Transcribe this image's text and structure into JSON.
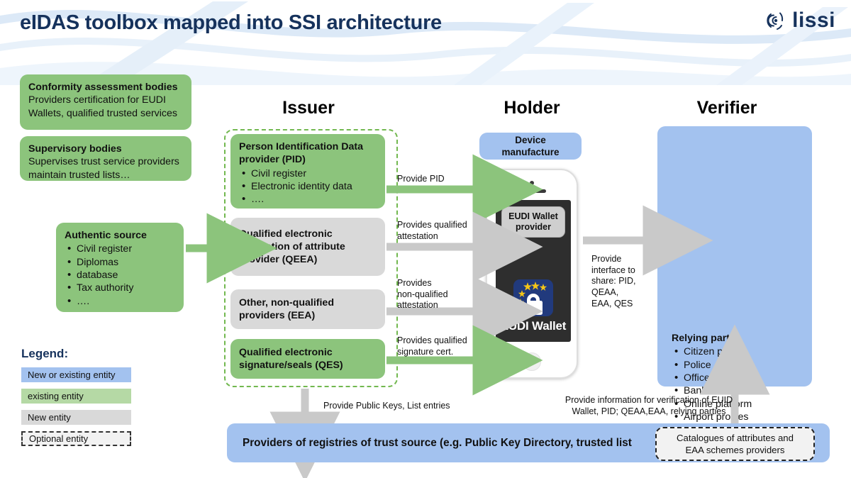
{
  "header": {
    "title": "eIDAS toolbox mapped into SSI architecture",
    "logo_text": "lissi",
    "logo_icon": "fingerprint-icon"
  },
  "columns": {
    "issuer": "Issuer",
    "holder": "Holder",
    "verifier": "Verifier"
  },
  "left_boxes": [
    {
      "title": "Conformity assessment bodies",
      "lines": [
        "Providers certification for EUDI",
        "Wallets, qualified trusted services"
      ]
    },
    {
      "title": "Supervisory bodies",
      "lines": [
        "Supervises trust service providers",
        "maintain trusted lists…"
      ]
    }
  ],
  "authentic_source": {
    "title": "Authentic source",
    "items": [
      "Civil register",
      "Diplomas",
      "database",
      "Tax authority",
      "…."
    ]
  },
  "issuer_boxes": [
    {
      "title_lines": [
        "Person Identification Data",
        "provider (PID)"
      ],
      "items": [
        "Civil register",
        "Electronic identity data",
        "…."
      ],
      "style": "green"
    },
    {
      "title_lines": [
        "Qualified electronic",
        "attestation of attribute",
        "provider (QEEA)"
      ],
      "items": [],
      "style": "gray"
    },
    {
      "title_lines": [
        "Other, non-qualified",
        "providers (EEA)"
      ],
      "items": [],
      "style": "gray"
    },
    {
      "title_lines": [
        "Qualified electronic",
        "signature/seals (QES)"
      ],
      "items": [],
      "style": "green"
    }
  ],
  "holder": {
    "device_manufacture": [
      "Device",
      "manufacture"
    ],
    "wallet_provider": [
      "EUDI Wallet",
      "provider"
    ],
    "wallet_label": "EUDI Wallet",
    "eu_badge_icon": "eu-flag-padlock-icon"
  },
  "verifier": {
    "title": "Relying party",
    "items": [
      "Citizen portal",
      "Police",
      "Officer",
      "Bank",
      "Online platform",
      "Airport proxies"
    ]
  },
  "arrow_labels": {
    "provide_pid": "Provide PID",
    "qualified_attestation": [
      "Provides qualified",
      "attestation"
    ],
    "non_qualified_attestation": [
      "Provides",
      "non-qualified",
      "attestation"
    ],
    "qualified_signature": [
      "Provides qualified",
      "signature cert."
    ],
    "provide_interface": [
      "Provide",
      "interface to",
      "share: PID,",
      "QEAA,",
      "EAA, QES"
    ],
    "public_keys": "Provide Public Keys, List entries",
    "verification_info": [
      "Provide information for verification of EUID",
      "Wallet, PID; QEAA,EAA, relying parties"
    ]
  },
  "bottom": {
    "registry_bar": "Providers of registries of trust source (e.g. Public Key Directory, trusted list",
    "catalogue": [
      "Catalogues of attributes and",
      "EAA schemes providers"
    ]
  },
  "legend": {
    "title": "Legend:",
    "items": [
      {
        "label": "New or existing entity",
        "style": "blue"
      },
      {
        "label": "existing entity",
        "style": "green"
      },
      {
        "label": "New entity",
        "style": "gray"
      },
      {
        "label": "Optional entity",
        "style": "dashed"
      }
    ]
  },
  "colors": {
    "title_navy": "#16325c",
    "green_fill": "#8cc47c",
    "green_dash": "#72b84f",
    "gray_fill": "#d9d9d9",
    "blue_fill": "#a3c2ef",
    "arrow_green": "#8cc47c",
    "arrow_gray": "#c9c9c9",
    "eu_blue": "#213a7d",
    "eu_star": "#f5c518"
  }
}
